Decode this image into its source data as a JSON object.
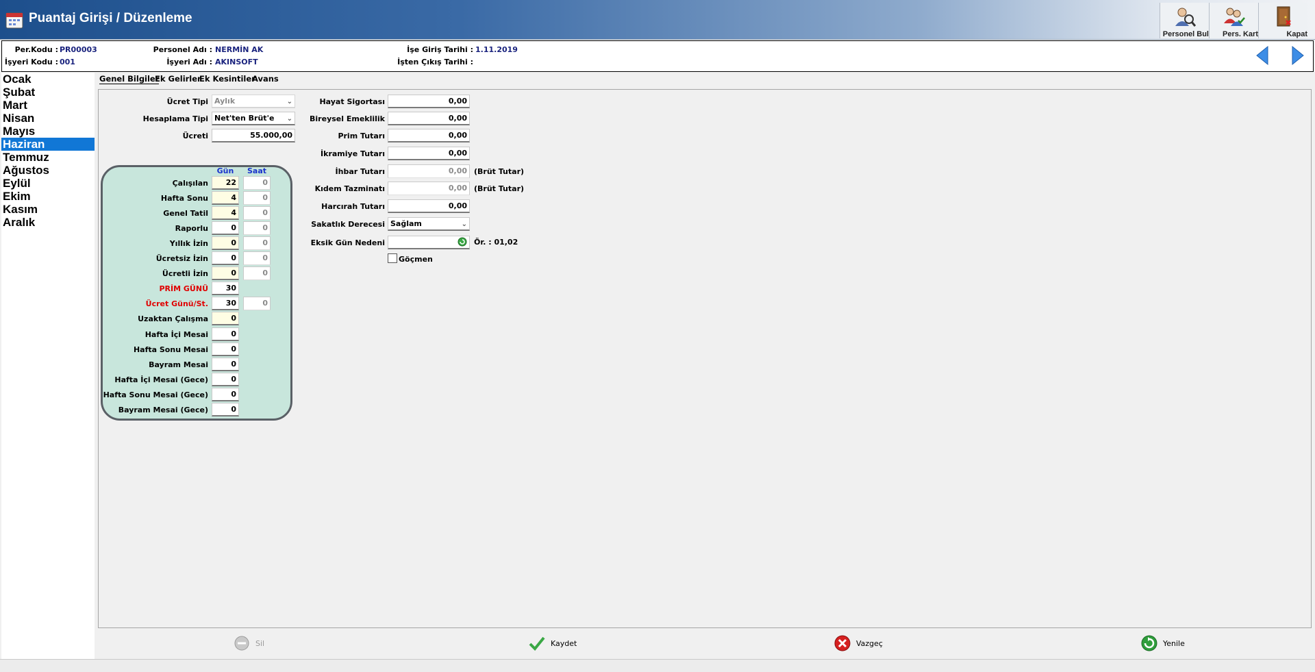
{
  "window": {
    "title": "Puantaj Girişi / Düzenleme"
  },
  "toolbar": {
    "personel_bul": "Personel Bul",
    "pers_kart": "Pers. Kart",
    "kapat": "Kapat"
  },
  "info": {
    "per_kodu_label": "Per.Kodu :",
    "per_kodu": "PR00003",
    "personel_adi_label": "Personel Adı :",
    "personel_adi": "NERMİN AK",
    "ise_giris_label": "İşe Giriş Tarihi :",
    "ise_giris": "1.11.2019",
    "isyeri_kodu_label": "İşyeri Kodu :",
    "isyeri_kodu": "001",
    "isyeri_adi_label": "İşyeri Adı :",
    "isyeri_adi": "AKINSOFT",
    "isten_cikis_label": "İşten Çıkış Tarihi :",
    "isten_cikis": ""
  },
  "months": [
    "Ocak",
    "Şubat",
    "Mart",
    "Nisan",
    "Mayıs",
    "Haziran",
    "Temmuz",
    "Ağustos",
    "Eylül",
    "Ekim",
    "Kasım",
    "Aralık"
  ],
  "selected_month": "Haziran",
  "tabs": [
    "Genel Bilgiler",
    "Ek Gelirler",
    "Ek Kesintiler",
    "Avans"
  ],
  "active_tab": "Genel Bilgiler",
  "general": {
    "ucret_tipi_label": "Ücret Tipi",
    "ucret_tipi": "Aylık",
    "hesaplama_tipi_label": "Hesaplama Tipi",
    "hesaplama_tipi": "Net'ten Brüt'e",
    "ucreti_label": "Ücreti",
    "ucreti": "55.000,00"
  },
  "days": {
    "col_gun": "Gün",
    "col_saat": "Saat",
    "rows": [
      {
        "label": "Çalışılan",
        "gun": "22",
        "saat": "0"
      },
      {
        "label": "Hafta Sonu",
        "gun": "4",
        "saat": "0"
      },
      {
        "label": "Genel Tatil",
        "gun": "4",
        "saat": "0"
      },
      {
        "label": "Raporlu",
        "gun": "0",
        "saat": "0"
      },
      {
        "label": "Yıllık İzin",
        "gun": "0",
        "saat": "0"
      },
      {
        "label": "Ücretsiz İzin",
        "gun": "0",
        "saat": "0"
      },
      {
        "label": "Ücretli İzin",
        "gun": "0",
        "saat": "0"
      },
      {
        "label": "PRİM GÜNÜ",
        "gun": "30",
        "saat": ""
      },
      {
        "label": "Ücret Günü/St.",
        "gun": "30",
        "saat": "0"
      },
      {
        "label": "Uzaktan Çalışma",
        "gun": "0",
        "saat": ""
      },
      {
        "label": "Hafta İçi Mesai",
        "gun": "0",
        "saat": ""
      },
      {
        "label": "Hafta Sonu Mesai",
        "gun": "0",
        "saat": ""
      },
      {
        "label": "Bayram Mesai",
        "gun": "0",
        "saat": ""
      },
      {
        "label": "Hafta İçi Mesai (Gece)",
        "gun": "0",
        "saat": ""
      },
      {
        "label": "Hafta Sonu Mesai (Gece)",
        "gun": "0",
        "saat": ""
      },
      {
        "label": "Bayram Mesai (Gece)",
        "gun": "0",
        "saat": ""
      }
    ]
  },
  "right": {
    "hayat_sigortasi_label": "Hayat Sigortası",
    "hayat_sigortasi": "0,00",
    "bireysel_emeklilik_label": "Bireysel Emeklilik",
    "bireysel_emeklilik": "0,00",
    "prim_tutari_label": "Prim Tutarı",
    "prim_tutari": "0,00",
    "ikramiye_label": "İkramiye Tutarı",
    "ikramiye": "0,00",
    "ihbar_label": "İhbar Tutarı",
    "ihbar": "0,00",
    "ihbar_suffix": "(Brüt Tutar)",
    "kidem_label": "Kıdem Tazminatı",
    "kidem": "0,00",
    "kidem_suffix": "(Brüt Tutar)",
    "harcirah_label": "Harcırah Tutarı",
    "harcirah": "0,00",
    "sakatlik_label": "Sakatlık Derecesi",
    "sakatlik": "Sağlam",
    "eksik_gun_label": "Eksik Gün Nedeni",
    "eksik_gun": "",
    "eksik_gun_hint": "Ör. : 01,02",
    "gocmen_label": "Göçmen"
  },
  "buttons": {
    "sil": "Sil",
    "kaydet": "Kaydet",
    "vazgec": "Vazgeç",
    "yenile": "Yenile"
  }
}
